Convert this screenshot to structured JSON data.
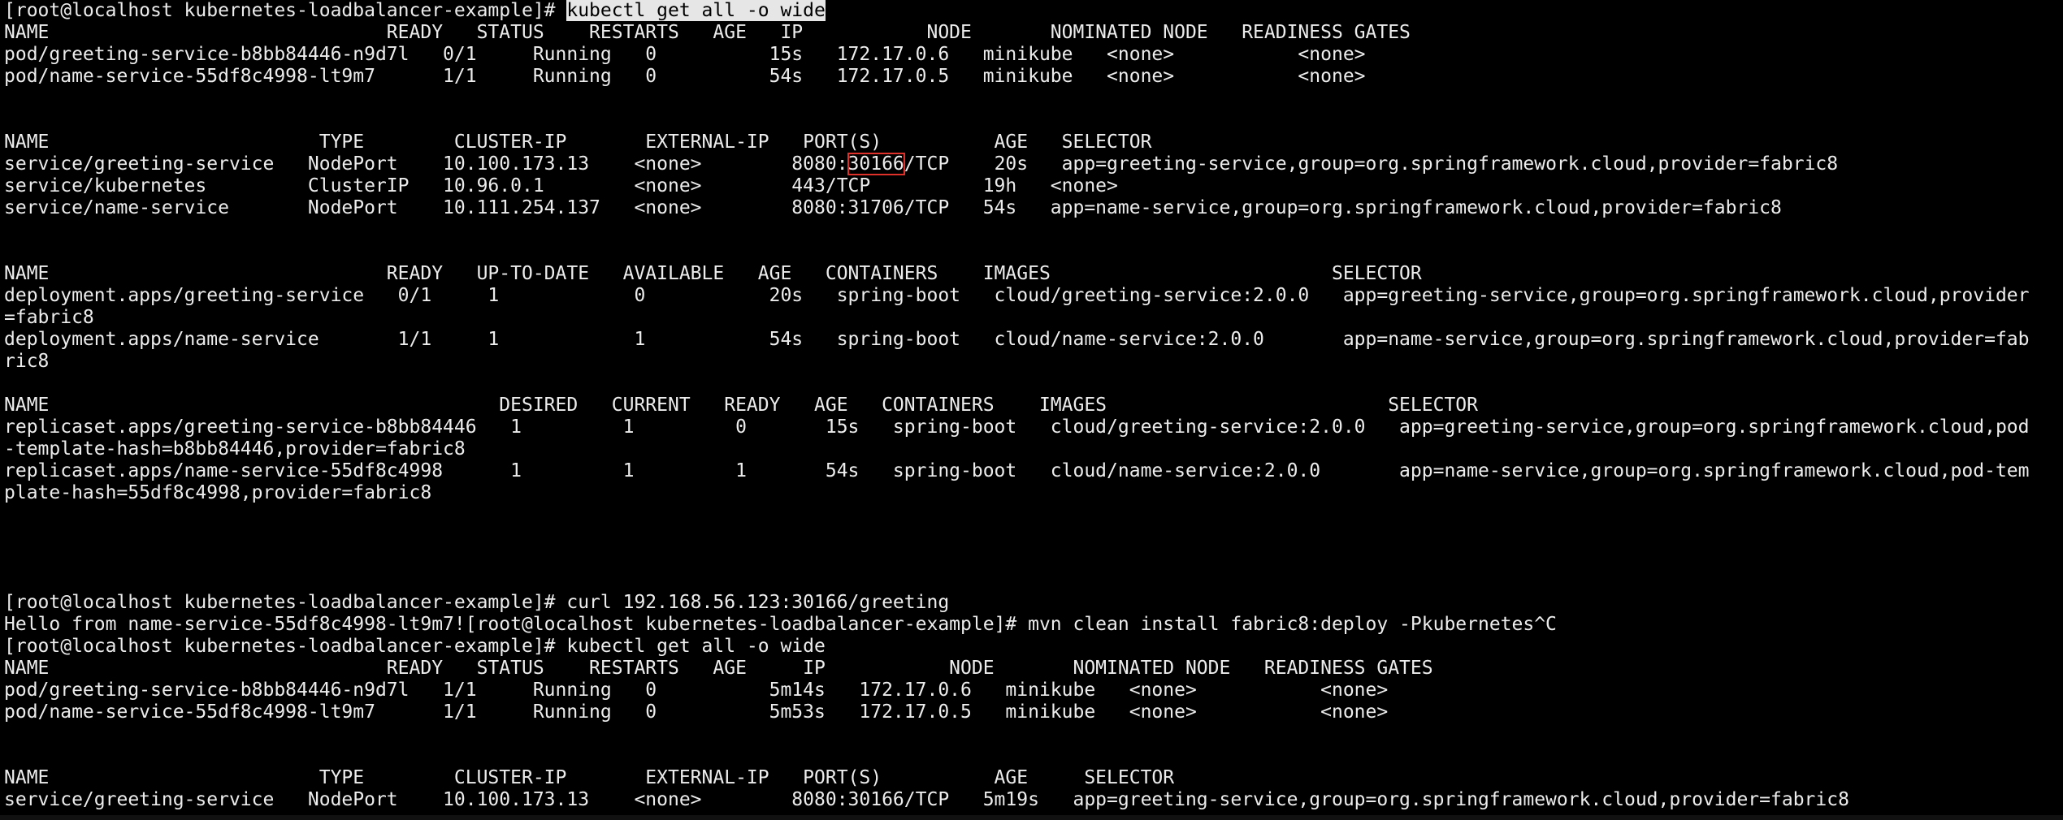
{
  "terminal": {
    "background": "#000000",
    "foreground": "#ececec",
    "highlight_background": "#e6e6e6",
    "box_color": "#e0302a",
    "lines": [
      [
        {
          "text": "[root@localhost kubernetes-loadbalancer-example]# "
        },
        {
          "text": "kubectl get all -o wide",
          "style": "cmd-hl"
        }
      ],
      [
        {
          "text": "NAME                              READY   STATUS    RESTARTS   AGE   IP           NODE       NOMINATED NODE   READINESS GATES"
        }
      ],
      [
        {
          "text": "pod/greeting-service-b8bb84446-n9d7l   0/1     Running   0          15s   172.17.0.6   minikube   <none>           <none>"
        }
      ],
      [
        {
          "text": "pod/name-service-55df8c4998-lt9m7      1/1     Running   0          54s   172.17.0.5   minikube   <none>           <none>"
        }
      ],
      [
        {
          "text": ""
        }
      ],
      [
        {
          "text": ""
        }
      ],
      [
        {
          "text": "NAME                        TYPE        CLUSTER-IP       EXTERNAL-IP   PORT(S)          AGE   SELECTOR"
        }
      ],
      [
        {
          "text": "service/greeting-service   NodePort    10.100.173.13    <none>        8080:"
        },
        {
          "text": "30166",
          "style": "box"
        },
        {
          "text": "/TCP    20s   app=greeting-service,group=org.springframework.cloud,provider=fabric8"
        }
      ],
      [
        {
          "text": "service/kubernetes         ClusterIP   10.96.0.1        <none>        443/TCP          19h   <none>"
        }
      ],
      [
        {
          "text": "service/name-service       NodePort    10.111.254.137   <none>        8080:31706/TCP   54s   app=name-service,group=org.springframework.cloud,provider=fabric8"
        }
      ],
      [
        {
          "text": ""
        }
      ],
      [
        {
          "text": ""
        }
      ],
      [
        {
          "text": "NAME                              READY   UP-TO-DATE   AVAILABLE   AGE   CONTAINERS    IMAGES                         SELECTOR"
        }
      ],
      [
        {
          "text": "deployment.apps/greeting-service   0/1     1            0           20s   spring-boot   cloud/greeting-service:2.0.0   app=greeting-service,group=org.springframework.cloud,provider"
        }
      ],
      [
        {
          "text": "=fabric8"
        }
      ],
      [
        {
          "text": "deployment.apps/name-service       1/1     1            1           54s   spring-boot   cloud/name-service:2.0.0       app=name-service,group=org.springframework.cloud,provider=fab"
        }
      ],
      [
        {
          "text": "ric8"
        }
      ],
      [
        {
          "text": ""
        }
      ],
      [
        {
          "text": "NAME                                        DESIRED   CURRENT   READY   AGE   CONTAINERS    IMAGES                         SELECTOR"
        }
      ],
      [
        {
          "text": "replicaset.apps/greeting-service-b8bb84446   1         1         0       15s   spring-boot   cloud/greeting-service:2.0.0   app=greeting-service,group=org.springframework.cloud,pod"
        }
      ],
      [
        {
          "text": "-template-hash=b8bb84446,provider=fabric8"
        }
      ],
      [
        {
          "text": "replicaset.apps/name-service-55df8c4998      1         1         1       54s   spring-boot   cloud/name-service:2.0.0       app=name-service,group=org.springframework.cloud,pod-tem"
        }
      ],
      [
        {
          "text": "plate-hash=55df8c4998,provider=fabric8"
        }
      ],
      [
        {
          "text": ""
        }
      ],
      [
        {
          "text": ""
        }
      ],
      [
        {
          "text": ""
        }
      ],
      [
        {
          "text": ""
        }
      ],
      [
        {
          "text": "[root@localhost kubernetes-loadbalancer-example]# curl 192.168.56.123:30166/greeting"
        }
      ],
      [
        {
          "text": "Hello from name-service-55df8c4998-lt9m7![root@localhost kubernetes-loadbalancer-example]# mvn clean install fabric8:deploy -Pkubernetes^C"
        }
      ],
      [
        {
          "text": "[root@localhost kubernetes-loadbalancer-example]# kubectl get all -o wide"
        }
      ],
      [
        {
          "text": "NAME                              READY   STATUS    RESTARTS   AGE     IP           NODE       NOMINATED NODE   READINESS GATES"
        }
      ],
      [
        {
          "text": "pod/greeting-service-b8bb84446-n9d7l   1/1     Running   0          5m14s   172.17.0.6   minikube   <none>           <none>"
        }
      ],
      [
        {
          "text": "pod/name-service-55df8c4998-lt9m7      1/1     Running   0          5m53s   172.17.0.5   minikube   <none>           <none>"
        }
      ],
      [
        {
          "text": ""
        }
      ],
      [
        {
          "text": ""
        }
      ],
      [
        {
          "text": "NAME                        TYPE        CLUSTER-IP       EXTERNAL-IP   PORT(S)          AGE     SELECTOR"
        }
      ],
      [
        {
          "text": "service/greeting-service   NodePort    10.100.173.13    <none>        8080:30166/TCP   5m19s   app=greeting-service,group=org.springframework.cloud,provider=fabric8"
        }
      ]
    ]
  }
}
